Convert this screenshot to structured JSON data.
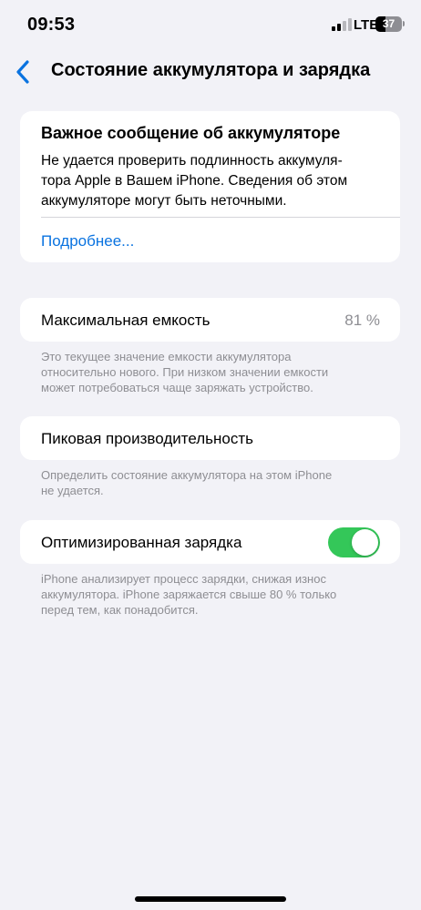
{
  "status_bar": {
    "time": "09:53",
    "network": "LTE",
    "battery_level": "37",
    "signal_bars": 2,
    "signal_max": 4
  },
  "nav": {
    "back_icon": "chevron-left-icon",
    "title": "Состояние аккумулятора и зарядка"
  },
  "message": {
    "title": "Важное сообщение об аккумуляторе",
    "body_lines": [
      "Не удается проверить подлинность аккумуля-",
      "тора Apple в Вашем iPhone. Сведения об этом",
      "аккумуляторе могут быть неточными."
    ],
    "link": "Подробнее..."
  },
  "max_capacity": {
    "label": "Максимальная емкость",
    "value": "81 %",
    "footer_lines": [
      "Это текущее значение емкости аккумулятора",
      "относительно нового. При низком значении емкости",
      "может потребоваться чаще заряжать устройство."
    ]
  },
  "peak_performance": {
    "label": "Пиковая производительность",
    "footer_lines": [
      "Определить состояние аккумулятора на этом iPhone",
      "не удается."
    ]
  },
  "optimized_charging": {
    "label": "Оптимизированная зарядка",
    "enabled": true,
    "footer_lines": [
      "iPhone анализирует процесс зарядки, снижая износ",
      "аккумулятора. iPhone заряжается свыше 80 % только",
      "перед тем, как понадобится."
    ]
  },
  "colors": {
    "accent_link": "#0a73e0",
    "toggle_on": "#34c759",
    "background": "#f2f2f7",
    "secondary_text": "#8e8e93"
  }
}
